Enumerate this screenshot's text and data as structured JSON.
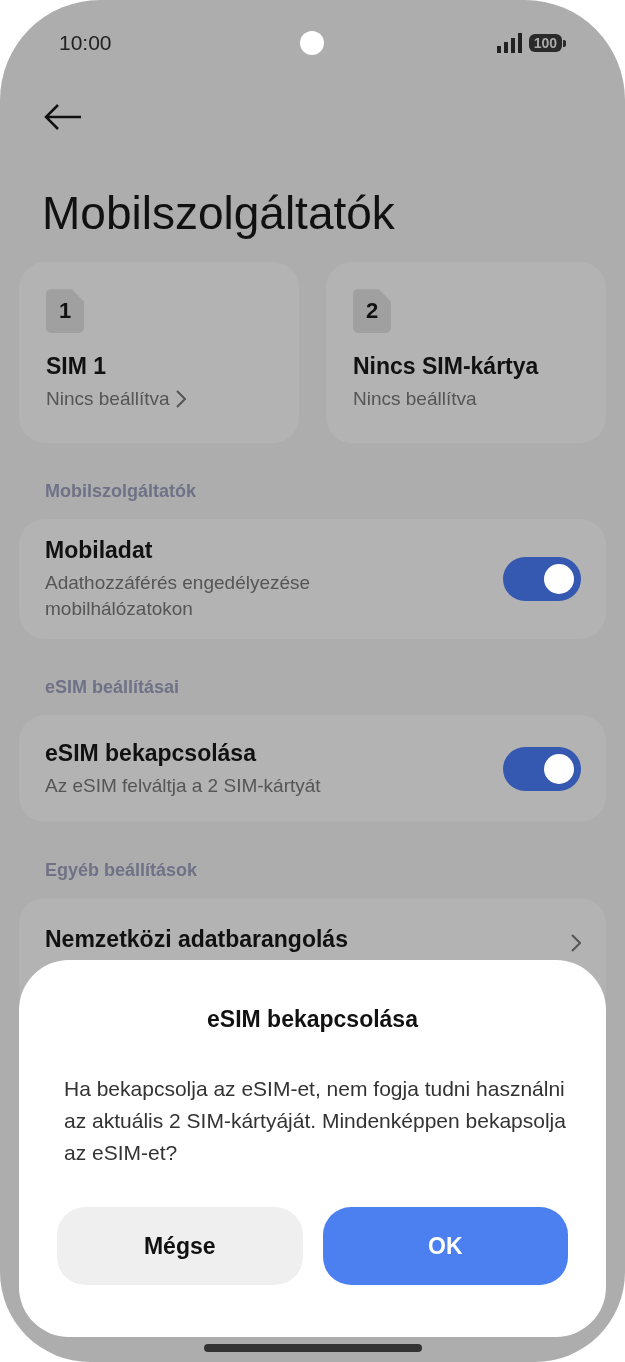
{
  "status_bar": {
    "time": "10:00",
    "battery": "100"
  },
  "title": "Mobilszolgáltatók",
  "sim_cards": [
    {
      "slot": "1",
      "name": "SIM 1",
      "status": "Nincs beállítva",
      "chevron": true
    },
    {
      "slot": "2",
      "name": "Nincs SIM-kártya",
      "status": "Nincs beállítva",
      "chevron": false
    }
  ],
  "sections": [
    {
      "header": "Mobilszolgáltatók",
      "items": [
        {
          "kind": "toggle",
          "title": "Mobiladat",
          "subtitle": "Adathozzáférés engedélyezése mobilhálózatokon",
          "on": true
        }
      ]
    },
    {
      "header": "eSIM beállításai",
      "items": [
        {
          "kind": "toggle",
          "title": "eSIM bekapcsolása",
          "subtitle": "Az eSIM felváltja a 2 SIM-kártyát",
          "on": true
        }
      ]
    },
    {
      "header": "Egyéb beállítások",
      "items": [
        {
          "kind": "link",
          "title": "Nemzetközi adatbarangolás"
        }
      ]
    }
  ],
  "dialog": {
    "title": "eSIM bekapcsolása",
    "message": "Ha bekapcsolja az eSIM-et, nem fogja tudni használni az aktuális 2 SIM-kártyáját. Mindenképpen bekapsolja az eSIM-et?",
    "buttons": [
      {
        "label": "Mégse",
        "kind": "secondary"
      },
      {
        "label": "OK",
        "kind": "primary"
      }
    ]
  }
}
